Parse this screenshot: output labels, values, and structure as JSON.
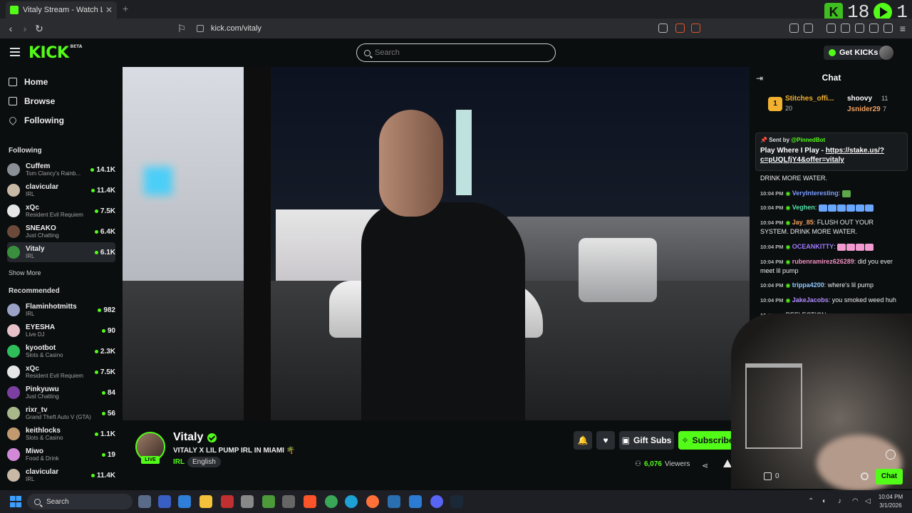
{
  "browser": {
    "tab_title": "Vitaly Stream - Watch Live on",
    "url": "kick.com/vitaly",
    "overlay_left": "K",
    "overlay_counter": "18",
    "overlay_counter2": "1"
  },
  "header": {
    "logo": "KICK",
    "logo_tag": "BETA",
    "search_placeholder": "Search",
    "get_kicks": "Get KICKs"
  },
  "sidebar": {
    "nav": [
      {
        "label": "Home"
      },
      {
        "label": "Browse"
      },
      {
        "label": "Following"
      }
    ],
    "following_title": "Following",
    "following": [
      {
        "name": "Cuffem",
        "category": "Tom Clancy's Rainb...",
        "viewers": "14.1K",
        "color": "#8a8f95"
      },
      {
        "name": "clavicular",
        "category": "IRL",
        "viewers": "11.4K",
        "color": "#c8b9a6"
      },
      {
        "name": "xQc",
        "category": "Resident Evil Requiem",
        "viewers": "7.5K",
        "color": "#e6e6e6"
      },
      {
        "name": "SNEAKO",
        "category": "Just Chatting",
        "viewers": "6.4K",
        "color": "#6b4a3a"
      },
      {
        "name": "Vitaly",
        "category": "IRL",
        "viewers": "6.1K",
        "color": "#3a8f3f"
      }
    ],
    "show_more": "Show More",
    "recommended_title": "Recommended",
    "recommended": [
      {
        "name": "Flaminhotmitts",
        "category": "IRL",
        "viewers": "982",
        "color": "#9aa2c8"
      },
      {
        "name": "EYESHA",
        "category": "Live DJ",
        "viewers": "90",
        "color": "#e8c0c8"
      },
      {
        "name": "kyootbot",
        "category": "Slots & Casino",
        "viewers": "2.3K",
        "color": "#2fbf5a"
      },
      {
        "name": "xQc",
        "category": "Resident Evil Requiem",
        "viewers": "7.5K",
        "color": "#e6e6e6"
      },
      {
        "name": "Pinkyuwu",
        "category": "Just Chatting",
        "viewers": "84",
        "color": "#7a3fa0"
      },
      {
        "name": "rixr_tv",
        "category": "Grand Theft Auto V (GTA)",
        "viewers": "56",
        "color": "#a8b88a"
      },
      {
        "name": "keithlocks",
        "category": "Slots & Casino",
        "viewers": "1.1K",
        "color": "#c29a70"
      },
      {
        "name": "Miwo",
        "category": "Food & Drink",
        "viewers": "19",
        "color": "#d28ad8"
      },
      {
        "name": "clavicular",
        "category": "IRL",
        "viewers": "11.4K",
        "color": "#c8b9a6"
      }
    ]
  },
  "stream": {
    "name": "Vitaly",
    "live_label": "LIVE",
    "title": "VITALY X LIL PUMP IRL IN MIAMI 🌴",
    "category": "IRL",
    "language": "English",
    "gift_subs": "Gift Subs",
    "subscribe": "Subscribe",
    "viewers_count": "6,076",
    "viewers_label": "Viewers"
  },
  "chat": {
    "title": "Chat",
    "leaderboard": {
      "rank": "1",
      "top_name": "Stitches_offi...",
      "top_value": "20",
      "second_name": "shoovy",
      "second_value": "11",
      "third_name": "Jsnider29",
      "third_value": "7"
    },
    "pinned": {
      "sent_by": "Sent by",
      "bot": "@PinnedBot",
      "message": "Play Where I Play - ",
      "link": "https://stake.us/?c=pUQLfjY4&offer=vitaly"
    },
    "messages": [
      {
        "time": "",
        "user": "",
        "text": "DRINK MORE WATER.",
        "color": "#eee"
      },
      {
        "time": "10:04 PM",
        "user": "VeryInteresting",
        "text": ":",
        "color": "#7b9cff"
      },
      {
        "time": "10:04 PM",
        "user": "Veghen",
        "text": ":",
        "color": "#53e0a8"
      },
      {
        "time": "10:04 PM",
        "user": "Jay_85",
        "text": ": FLUSH OUT YOUR SYSTEM. DRINK MORE WATER.",
        "color": "#f0a060"
      },
      {
        "time": "10:04 PM",
        "user": "OCEANKITTY",
        "text": ":",
        "color": "#9f7bff"
      },
      {
        "time": "10:04 PM",
        "user": "rubenramirez626289",
        "text": ": did you ever meet lil pump",
        "color": "#f08fc0"
      },
      {
        "time": "10:04 PM",
        "user": "trippa4200",
        "text": ": where's lil pump",
        "color": "#8fc8ff"
      },
      {
        "time": "10:04 PM",
        "user": "JakeJacobs",
        "text": ": you smoked weed huh",
        "color": "#b18cff"
      },
      {
        "time": "10:04 PM",
        "user": "",
        "text": "REFLECTION",
        "color": "#eee"
      }
    ],
    "gift_count": "0",
    "chat_button": "Chat"
  },
  "taskbar": {
    "search": "Search",
    "time": "10:04 PM",
    "date": "3/1/2026"
  }
}
